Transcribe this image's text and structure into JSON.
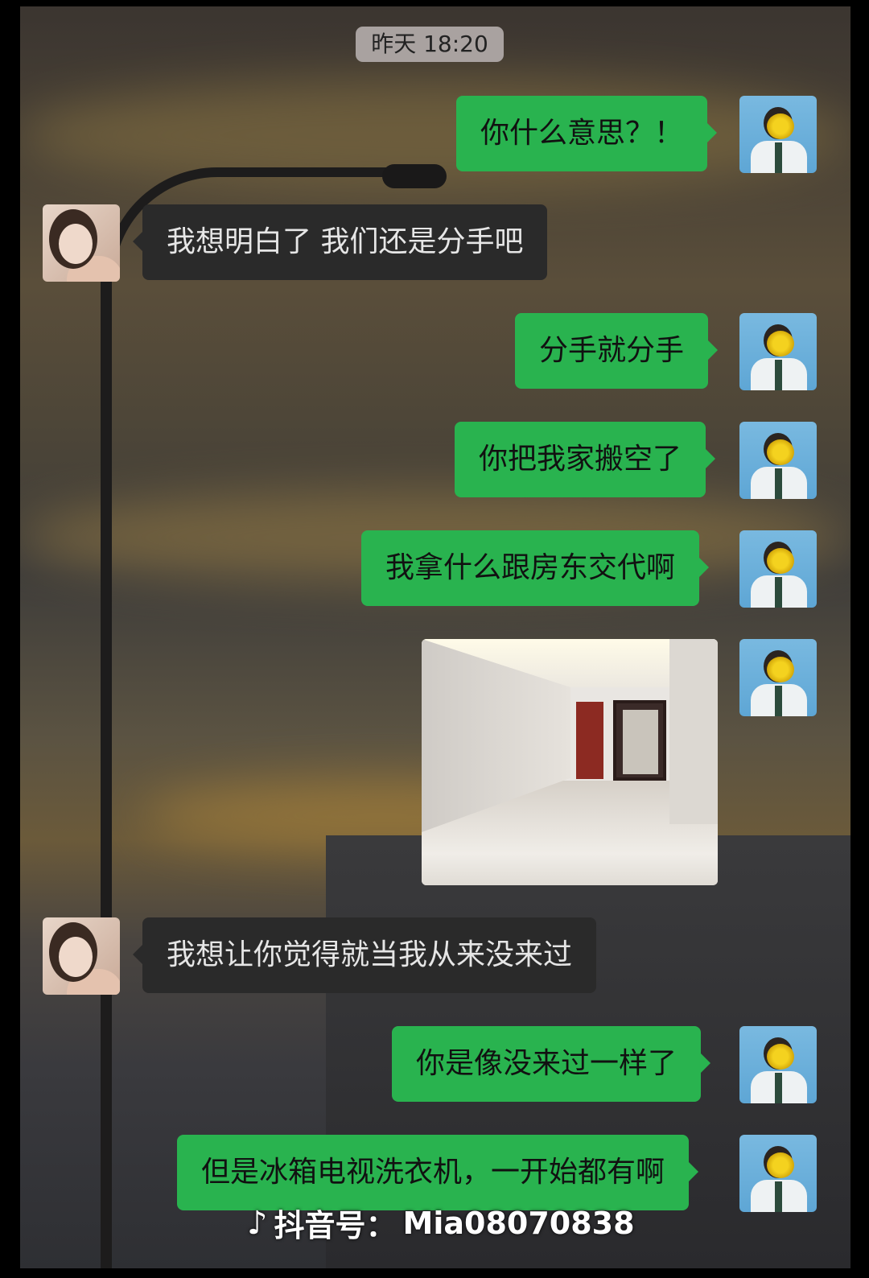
{
  "timestamp": "昨天 18:20",
  "messages": [
    {
      "from": "me",
      "text": "你什么意思？！"
    },
    {
      "from": "her",
      "text": "我想明白了 我们还是分手吧"
    },
    {
      "from": "me",
      "text": "分手就分手"
    },
    {
      "from": "me",
      "text": "你把我家搬空了"
    },
    {
      "from": "me",
      "text": "我拿什么跟房东交代啊"
    },
    {
      "from": "me",
      "type": "image"
    },
    {
      "from": "her",
      "text": "我想让你觉得就当我从来没来过"
    },
    {
      "from": "me",
      "text": "你是像没来过一样了"
    },
    {
      "from": "me",
      "text": "但是冰箱电视洗衣机，一开始都有啊"
    }
  ],
  "watermark": {
    "label": "抖音号：",
    "id": "Mia08070838"
  },
  "colors": {
    "my_bubble": "#29b34f",
    "her_bubble": "#2a2a2a"
  }
}
